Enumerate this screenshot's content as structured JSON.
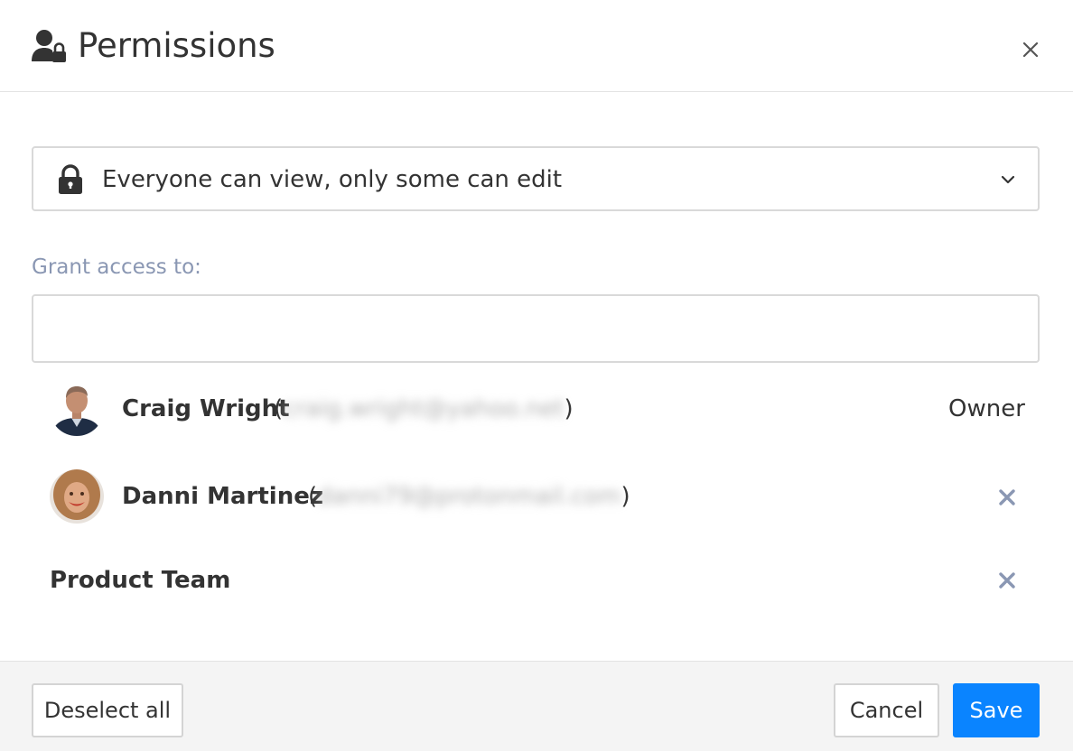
{
  "dialog": {
    "title": "Permissions",
    "header_icon": "user-lock-icon",
    "close_icon": "close-icon"
  },
  "visibility_select": {
    "icon": "lock-icon",
    "selected": "Everyone can view, only some can edit",
    "chevron_icon": "chevron-down-icon"
  },
  "grant": {
    "label": "Grant access to:",
    "input_value": ""
  },
  "members": [
    {
      "name": "Craig Wright",
      "email": "craig.wright@yahoo.net",
      "open_paren": "(",
      "close_paren": ")",
      "role": "Owner"
    },
    {
      "name": "Danni Martinez",
      "email": "danni79@protonmail.com",
      "open_paren": "(",
      "close_paren": ")",
      "remove_icon": "remove-icon"
    }
  ],
  "teams": [
    {
      "name": "Product Team",
      "remove_icon": "remove-icon"
    }
  ],
  "footer": {
    "deselect_label": "Deselect all",
    "cancel_label": "Cancel",
    "save_label": "Save"
  },
  "colors": {
    "primary": "#0a84ff",
    "label_muted": "#8a97b3",
    "remove_icon": "#8a97b3",
    "text": "#333333"
  }
}
